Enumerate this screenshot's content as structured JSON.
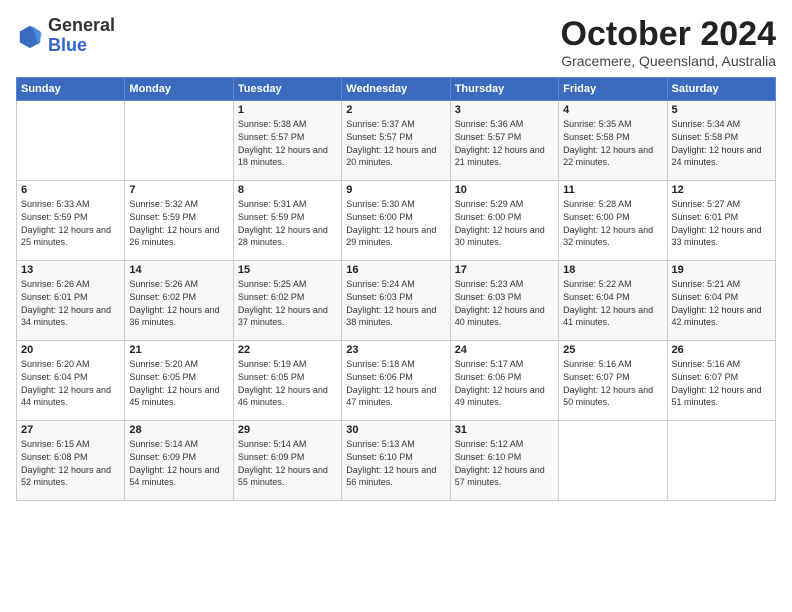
{
  "logo": {
    "general": "General",
    "blue": "Blue"
  },
  "title": "October 2024",
  "location": "Gracemere, Queensland, Australia",
  "days_of_week": [
    "Sunday",
    "Monday",
    "Tuesday",
    "Wednesday",
    "Thursday",
    "Friday",
    "Saturday"
  ],
  "weeks": [
    [
      {
        "day": "",
        "sunrise": "",
        "sunset": "",
        "daylight": ""
      },
      {
        "day": "",
        "sunrise": "",
        "sunset": "",
        "daylight": ""
      },
      {
        "day": "1",
        "sunrise": "Sunrise: 5:38 AM",
        "sunset": "Sunset: 5:57 PM",
        "daylight": "Daylight: 12 hours and 18 minutes."
      },
      {
        "day": "2",
        "sunrise": "Sunrise: 5:37 AM",
        "sunset": "Sunset: 5:57 PM",
        "daylight": "Daylight: 12 hours and 20 minutes."
      },
      {
        "day": "3",
        "sunrise": "Sunrise: 5:36 AM",
        "sunset": "Sunset: 5:57 PM",
        "daylight": "Daylight: 12 hours and 21 minutes."
      },
      {
        "day": "4",
        "sunrise": "Sunrise: 5:35 AM",
        "sunset": "Sunset: 5:58 PM",
        "daylight": "Daylight: 12 hours and 22 minutes."
      },
      {
        "day": "5",
        "sunrise": "Sunrise: 5:34 AM",
        "sunset": "Sunset: 5:58 PM",
        "daylight": "Daylight: 12 hours and 24 minutes."
      }
    ],
    [
      {
        "day": "6",
        "sunrise": "Sunrise: 5:33 AM",
        "sunset": "Sunset: 5:59 PM",
        "daylight": "Daylight: 12 hours and 25 minutes."
      },
      {
        "day": "7",
        "sunrise": "Sunrise: 5:32 AM",
        "sunset": "Sunset: 5:59 PM",
        "daylight": "Daylight: 12 hours and 26 minutes."
      },
      {
        "day": "8",
        "sunrise": "Sunrise: 5:31 AM",
        "sunset": "Sunset: 5:59 PM",
        "daylight": "Daylight: 12 hours and 28 minutes."
      },
      {
        "day": "9",
        "sunrise": "Sunrise: 5:30 AM",
        "sunset": "Sunset: 6:00 PM",
        "daylight": "Daylight: 12 hours and 29 minutes."
      },
      {
        "day": "10",
        "sunrise": "Sunrise: 5:29 AM",
        "sunset": "Sunset: 6:00 PM",
        "daylight": "Daylight: 12 hours and 30 minutes."
      },
      {
        "day": "11",
        "sunrise": "Sunrise: 5:28 AM",
        "sunset": "Sunset: 6:00 PM",
        "daylight": "Daylight: 12 hours and 32 minutes."
      },
      {
        "day": "12",
        "sunrise": "Sunrise: 5:27 AM",
        "sunset": "Sunset: 6:01 PM",
        "daylight": "Daylight: 12 hours and 33 minutes."
      }
    ],
    [
      {
        "day": "13",
        "sunrise": "Sunrise: 5:26 AM",
        "sunset": "Sunset: 6:01 PM",
        "daylight": "Daylight: 12 hours and 34 minutes."
      },
      {
        "day": "14",
        "sunrise": "Sunrise: 5:26 AM",
        "sunset": "Sunset: 6:02 PM",
        "daylight": "Daylight: 12 hours and 36 minutes."
      },
      {
        "day": "15",
        "sunrise": "Sunrise: 5:25 AM",
        "sunset": "Sunset: 6:02 PM",
        "daylight": "Daylight: 12 hours and 37 minutes."
      },
      {
        "day": "16",
        "sunrise": "Sunrise: 5:24 AM",
        "sunset": "Sunset: 6:03 PM",
        "daylight": "Daylight: 12 hours and 38 minutes."
      },
      {
        "day": "17",
        "sunrise": "Sunrise: 5:23 AM",
        "sunset": "Sunset: 6:03 PM",
        "daylight": "Daylight: 12 hours and 40 minutes."
      },
      {
        "day": "18",
        "sunrise": "Sunrise: 5:22 AM",
        "sunset": "Sunset: 6:04 PM",
        "daylight": "Daylight: 12 hours and 41 minutes."
      },
      {
        "day": "19",
        "sunrise": "Sunrise: 5:21 AM",
        "sunset": "Sunset: 6:04 PM",
        "daylight": "Daylight: 12 hours and 42 minutes."
      }
    ],
    [
      {
        "day": "20",
        "sunrise": "Sunrise: 5:20 AM",
        "sunset": "Sunset: 6:04 PM",
        "daylight": "Daylight: 12 hours and 44 minutes."
      },
      {
        "day": "21",
        "sunrise": "Sunrise: 5:20 AM",
        "sunset": "Sunset: 6:05 PM",
        "daylight": "Daylight: 12 hours and 45 minutes."
      },
      {
        "day": "22",
        "sunrise": "Sunrise: 5:19 AM",
        "sunset": "Sunset: 6:05 PM",
        "daylight": "Daylight: 12 hours and 46 minutes."
      },
      {
        "day": "23",
        "sunrise": "Sunrise: 5:18 AM",
        "sunset": "Sunset: 6:06 PM",
        "daylight": "Daylight: 12 hours and 47 minutes."
      },
      {
        "day": "24",
        "sunrise": "Sunrise: 5:17 AM",
        "sunset": "Sunset: 6:06 PM",
        "daylight": "Daylight: 12 hours and 49 minutes."
      },
      {
        "day": "25",
        "sunrise": "Sunrise: 5:16 AM",
        "sunset": "Sunset: 6:07 PM",
        "daylight": "Daylight: 12 hours and 50 minutes."
      },
      {
        "day": "26",
        "sunrise": "Sunrise: 5:16 AM",
        "sunset": "Sunset: 6:07 PM",
        "daylight": "Daylight: 12 hours and 51 minutes."
      }
    ],
    [
      {
        "day": "27",
        "sunrise": "Sunrise: 5:15 AM",
        "sunset": "Sunset: 6:08 PM",
        "daylight": "Daylight: 12 hours and 52 minutes."
      },
      {
        "day": "28",
        "sunrise": "Sunrise: 5:14 AM",
        "sunset": "Sunset: 6:09 PM",
        "daylight": "Daylight: 12 hours and 54 minutes."
      },
      {
        "day": "29",
        "sunrise": "Sunrise: 5:14 AM",
        "sunset": "Sunset: 6:09 PM",
        "daylight": "Daylight: 12 hours and 55 minutes."
      },
      {
        "day": "30",
        "sunrise": "Sunrise: 5:13 AM",
        "sunset": "Sunset: 6:10 PM",
        "daylight": "Daylight: 12 hours and 56 minutes."
      },
      {
        "day": "31",
        "sunrise": "Sunrise: 5:12 AM",
        "sunset": "Sunset: 6:10 PM",
        "daylight": "Daylight: 12 hours and 57 minutes."
      },
      {
        "day": "",
        "sunrise": "",
        "sunset": "",
        "daylight": ""
      },
      {
        "day": "",
        "sunrise": "",
        "sunset": "",
        "daylight": ""
      }
    ]
  ]
}
